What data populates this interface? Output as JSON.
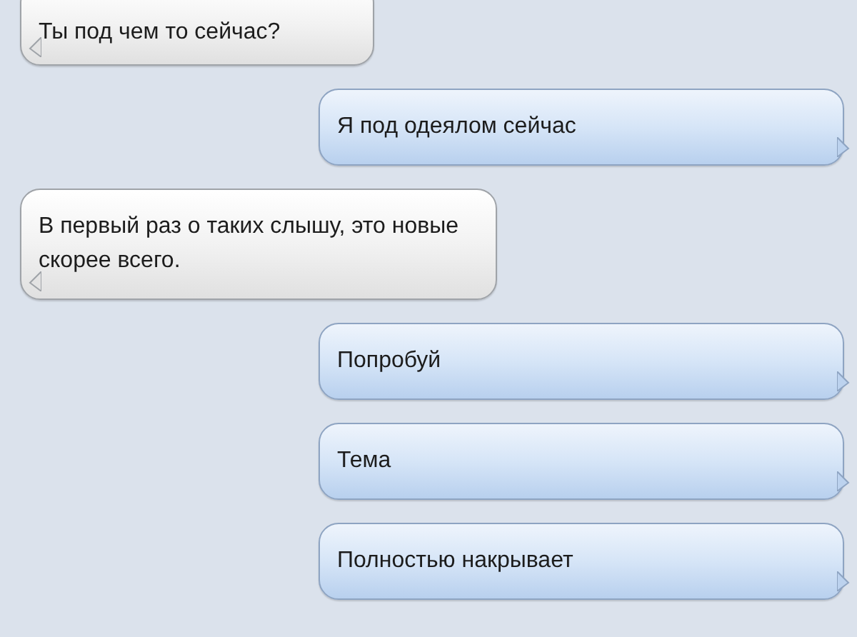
{
  "messages": [
    {
      "kind": "incoming",
      "text": "Ты под чем то сейчас?"
    },
    {
      "kind": "outgoing",
      "text": "Я под одеялом сейчас"
    },
    {
      "kind": "incoming",
      "text": "В первый раз о таких слышу, это новые скорее всего."
    },
    {
      "kind": "outgoing",
      "text": "Попробуй"
    },
    {
      "kind": "outgoing",
      "text": "Тема"
    },
    {
      "kind": "outgoing",
      "text": "Полностью накрывает"
    }
  ]
}
